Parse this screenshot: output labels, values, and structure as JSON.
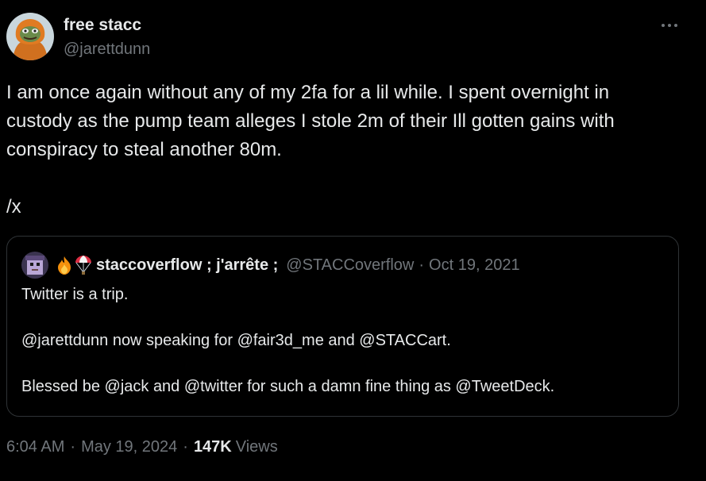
{
  "author": {
    "display_name": "free stacc",
    "handle": "@jarettdunn",
    "avatar_icon": "frog-avatar-orange-hoodie"
  },
  "more_icon": "more-horizontal-icon",
  "tweet": {
    "text": "I am once again without any of my 2fa for a lil while. I spent overnight in\ncustody as the pump team alleges I stole 2m of their Ill gotten gains with\nconspiracy to steal another 80m.\n\n/x"
  },
  "quote": {
    "avatar_icon": "pixel-character-avatar",
    "emojis": [
      "fire-emoji",
      "parachute-emoji"
    ],
    "display_name": "staccoverflow ; j'arrête ;",
    "handle": "@STACCoverflow",
    "separator": "·",
    "date": "Oct 19, 2021",
    "text": "Twitter is a trip.\n\n@jarettdunn now speaking for @fair3d_me and @STACCart.\n\nBlessed be @jack and @twitter for such a damn fine thing as @TweetDeck."
  },
  "meta": {
    "time": "6:04 AM",
    "separator": "·",
    "date": "May 19, 2024",
    "views_count": "147K",
    "views_label": "Views"
  },
  "colors": {
    "background": "#000000",
    "primary_text": "#e7e9ea",
    "secondary_text": "#71767b",
    "border": "#2f3336"
  }
}
